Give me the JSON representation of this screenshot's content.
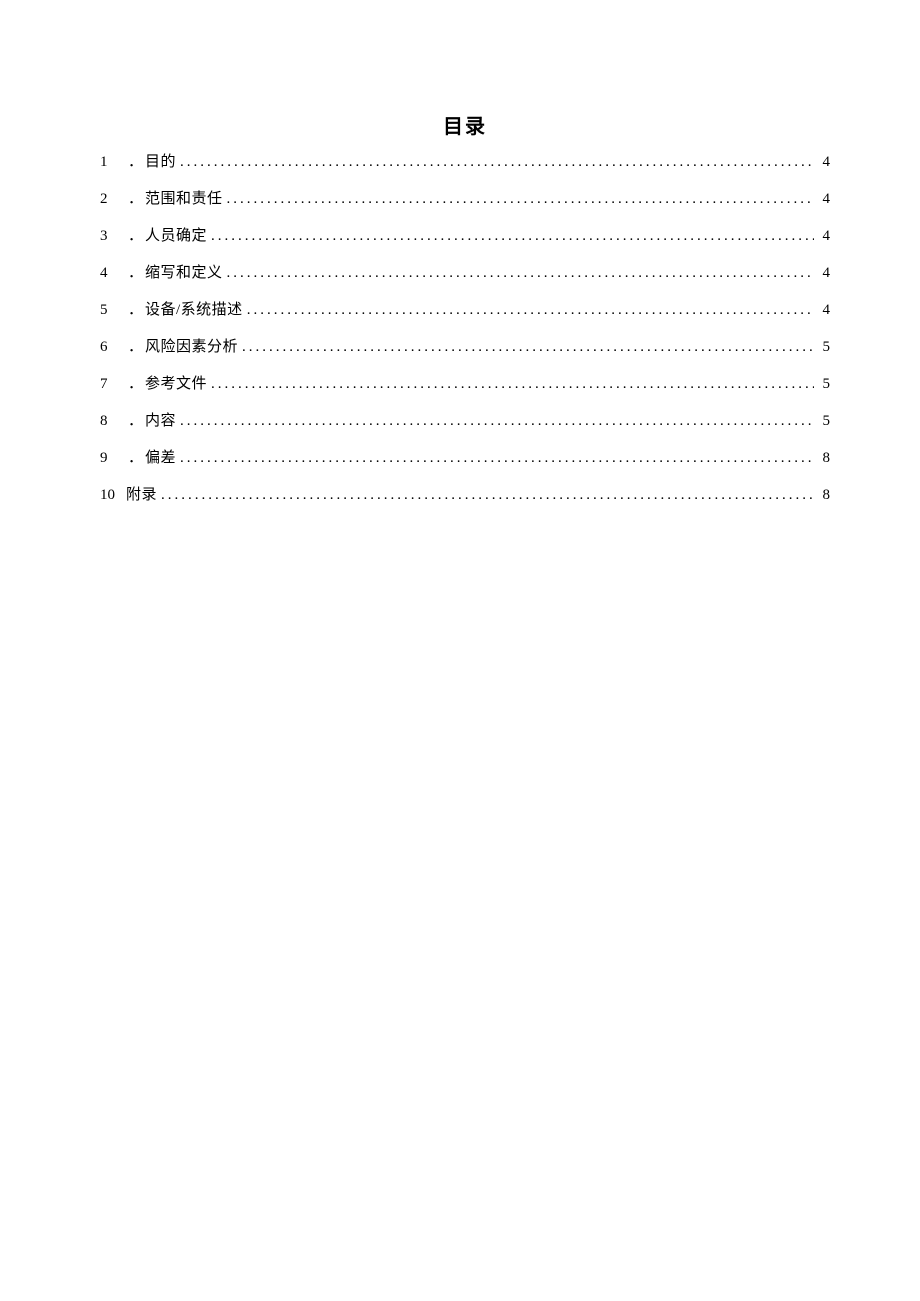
{
  "title": "目录",
  "toc": [
    {
      "num": "1",
      "sep": "．",
      "label": "目的",
      "page": "4"
    },
    {
      "num": "2",
      "sep": "．",
      "label": "范围和责任",
      "page": "4"
    },
    {
      "num": "3",
      "sep": "．",
      "label": "人员确定",
      "page": "4"
    },
    {
      "num": "4",
      "sep": "．",
      "label": "缩写和定义",
      "page": "4"
    },
    {
      "num": "5",
      "sep": "．",
      "label": "设备/系统描述",
      "page": "4"
    },
    {
      "num": "6",
      "sep": "．",
      "label": "风险因素分析",
      "page": "5"
    },
    {
      "num": "7",
      "sep": "．",
      "label": "参考文件",
      "page": "5"
    },
    {
      "num": "8",
      "sep": "．",
      "label": "内容",
      "page": "5"
    },
    {
      "num": "9",
      "sep": "．",
      "label": "偏差",
      "page": "8"
    },
    {
      "num": "10",
      "sep": "",
      "label": "附录",
      "page": "8"
    }
  ]
}
